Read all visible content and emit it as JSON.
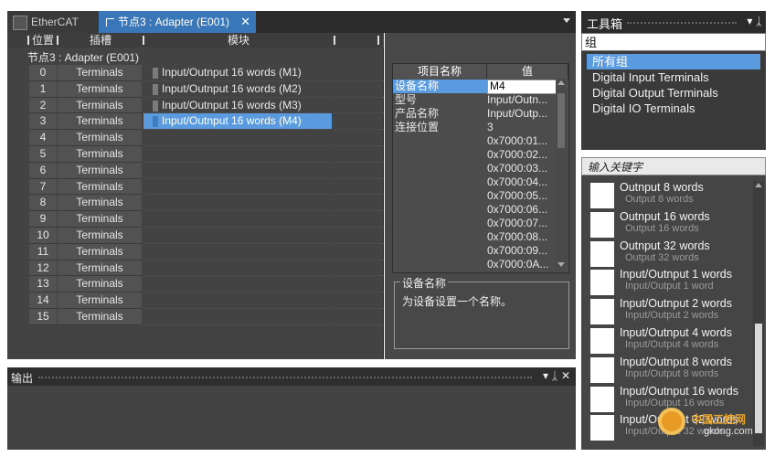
{
  "tabs": [
    {
      "label": "EtherCAT",
      "active": false
    },
    {
      "label": "节点3 : Adapter (E001)",
      "active": true
    }
  ],
  "grid": {
    "headers": {
      "position": "位置",
      "slot": "插槽",
      "module": "模块"
    },
    "node_title": "节点3 : Adapter (E001)",
    "rows": [
      {
        "pos": "0",
        "slot": "Terminals",
        "module": "Input/Outnput 16 words (M1)"
      },
      {
        "pos": "1",
        "slot": "Terminals",
        "module": "Input/Outnput 16 words (M2)"
      },
      {
        "pos": "2",
        "slot": "Terminals",
        "module": "Input/Outnput 16 words (M3)"
      },
      {
        "pos": "3",
        "slot": "Terminals",
        "module": "Input/Outnput 16 words (M4)",
        "selected": true
      },
      {
        "pos": "4",
        "slot": "Terminals",
        "module": ""
      },
      {
        "pos": "5",
        "slot": "Terminals",
        "module": ""
      },
      {
        "pos": "6",
        "slot": "Terminals",
        "module": ""
      },
      {
        "pos": "7",
        "slot": "Terminals",
        "module": ""
      },
      {
        "pos": "8",
        "slot": "Terminals",
        "module": ""
      },
      {
        "pos": "9",
        "slot": "Terminals",
        "module": ""
      },
      {
        "pos": "10",
        "slot": "Terminals",
        "module": ""
      },
      {
        "pos": "11",
        "slot": "Terminals",
        "module": ""
      },
      {
        "pos": "12",
        "slot": "Terminals",
        "module": ""
      },
      {
        "pos": "13",
        "slot": "Terminals",
        "module": ""
      },
      {
        "pos": "14",
        "slot": "Terminals",
        "module": ""
      },
      {
        "pos": "15",
        "slot": "Terminals",
        "module": ""
      }
    ]
  },
  "properties": {
    "headers": {
      "name": "项目名称",
      "value": "值"
    },
    "rows": [
      {
        "key": "设备名称",
        "value": "M4",
        "selected": true
      },
      {
        "key": "型号",
        "value": "Input/Outn..."
      },
      {
        "key": "产品名称",
        "value": "Input/Outp..."
      },
      {
        "key": "连接位置",
        "value": "3"
      },
      {
        "key": "",
        "value": "0x7000:01..."
      },
      {
        "key": "",
        "value": "0x7000:02..."
      },
      {
        "key": "",
        "value": "0x7000:03..."
      },
      {
        "key": "",
        "value": "0x7000:04..."
      },
      {
        "key": "",
        "value": "0x7000:05..."
      },
      {
        "key": "",
        "value": "0x7000:06..."
      },
      {
        "key": "",
        "value": "0x7000:07..."
      },
      {
        "key": "",
        "value": "0x7000:08..."
      },
      {
        "key": "",
        "value": "0x7000:09..."
      },
      {
        "key": "",
        "value": "0x7000:0A..."
      }
    ],
    "description": {
      "title": "设备名称",
      "text": "为设备设置一个名称。"
    }
  },
  "output": {
    "title": "输出",
    "pin": "ᛣ",
    "close": "✕"
  },
  "toolbox": {
    "title": "工具箱",
    "group_label": "组",
    "groups": [
      {
        "label": "所有组",
        "selected": true
      },
      {
        "label": "Digital Input Terminals"
      },
      {
        "label": "Digital Output Terminals"
      },
      {
        "label": "Digital IO Terminals"
      }
    ],
    "keyword_placeholder": "输入关键字",
    "items": [
      {
        "name": "Outnput 8 words",
        "sub": "Output 8 words"
      },
      {
        "name": "Outnput 16 words",
        "sub": "Output 16 words"
      },
      {
        "name": "Outnput 32 words",
        "sub": "Output 32 words"
      },
      {
        "name": "Input/Outnput 1 words",
        "sub": "Input/Output 1 word"
      },
      {
        "name": "Input/Outnput 2 words",
        "sub": "Input/Output 2 words"
      },
      {
        "name": "Input/Outnput 4 words",
        "sub": "Input/Output 4 words"
      },
      {
        "name": "Input/Outnput 8 words",
        "sub": "Input/Output 8 words"
      },
      {
        "name": "Input/Outnput 16 words",
        "sub": "Input/Output 16 words"
      },
      {
        "name": "Input/Outnput 32 words",
        "sub": "Input/Output 32 words"
      }
    ]
  },
  "watermark": {
    "name": "中国工控网",
    "url": "gkong.com"
  },
  "colors": {
    "accent": "#3a77b8",
    "selection": "#5a9be0",
    "panel": "#434343"
  }
}
